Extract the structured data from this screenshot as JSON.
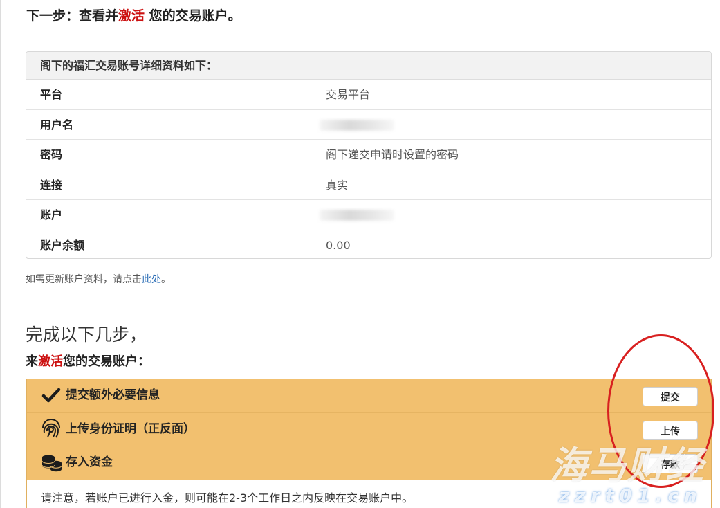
{
  "heading": {
    "prefix": "下一步：查看并",
    "highlight": "激活",
    "suffix": " 您的交易账户。"
  },
  "details": {
    "title": "阁下的福汇交易账号详细资料如下：",
    "rows": [
      {
        "label": "平台",
        "value": "交易平台"
      },
      {
        "label": "用户名",
        "value": ""
      },
      {
        "label": "密码",
        "value": "阁下递交申请时设置的密码"
      },
      {
        "label": "连接",
        "value": "真实"
      },
      {
        "label": "账户",
        "value": ""
      },
      {
        "label": "账户余额",
        "value": "0.00"
      }
    ]
  },
  "update_note": {
    "prefix": "如需更新账户资料，请点击",
    "link": "此处",
    "suffix": "。"
  },
  "steps_title": "完成以下几步，",
  "steps_subtitle": {
    "prefix": "来",
    "highlight": "激活",
    "suffix": "您的交易账户："
  },
  "steps": [
    {
      "label": "提交额外必要信息",
      "button": "提交",
      "icon": "checkmark-icon"
    },
    {
      "label": "上传身份证明（正反面）",
      "button": "上传",
      "icon": "fingerprint-icon"
    },
    {
      "label": "存入资金",
      "button": "存款",
      "icon": "coins-icon"
    }
  ],
  "notice": "请注意，若账户已进行入金，则可能在2-3个工作日之内反映在交易账户中。",
  "watermark": {
    "brand": "海马财经",
    "domain": "zzrt01.cn"
  },
  "colors": {
    "step_bg": "#f2c06f",
    "highlight": "#cc1111",
    "link": "#2a6cb5",
    "annotation": "#d82020"
  }
}
